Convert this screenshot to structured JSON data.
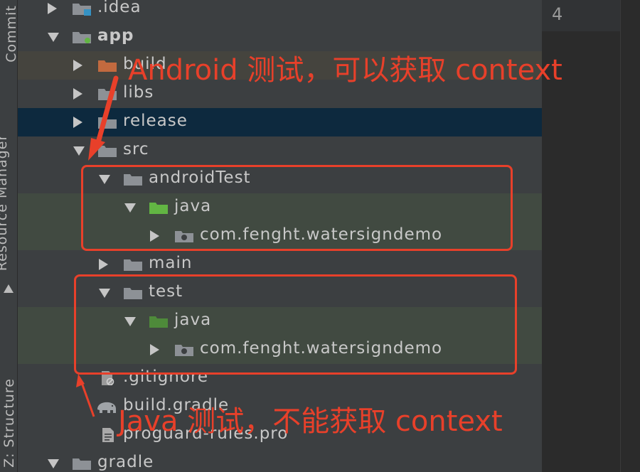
{
  "sidebar": {
    "tabs": [
      {
        "label": "Commit"
      },
      {
        "label": "Resource Manager"
      },
      {
        "label": "Z: Structure"
      }
    ]
  },
  "tree": {
    "rows": [
      {
        "label": ".idea"
      },
      {
        "label": "app"
      },
      {
        "label": "build"
      },
      {
        "label": "libs"
      },
      {
        "label": "release"
      },
      {
        "label": "src"
      },
      {
        "label": "androidTest"
      },
      {
        "label": "java"
      },
      {
        "label": "com.fenght.watersigndemo"
      },
      {
        "label": "main"
      },
      {
        "label": "test"
      },
      {
        "label": "java"
      },
      {
        "label": "com.fenght.watersigndemo"
      },
      {
        "label": ".gitignore"
      },
      {
        "label": "build.gradle"
      },
      {
        "label": "proguard-rules.pro"
      },
      {
        "label": "gradle"
      }
    ]
  },
  "editor": {
    "line_number": "4"
  },
  "annotations": {
    "top_note": "Android 测试，可以获取 context",
    "bottom_note": "Java 测试，不能获取 context",
    "color": "#e8402a"
  },
  "colors": {
    "folder_gray": "#8d9196",
    "folder_brown": "#c26a3f",
    "folder_green": "#62b543",
    "folder_green_dark": "#4e8a3a",
    "selection": "#0d293e"
  }
}
